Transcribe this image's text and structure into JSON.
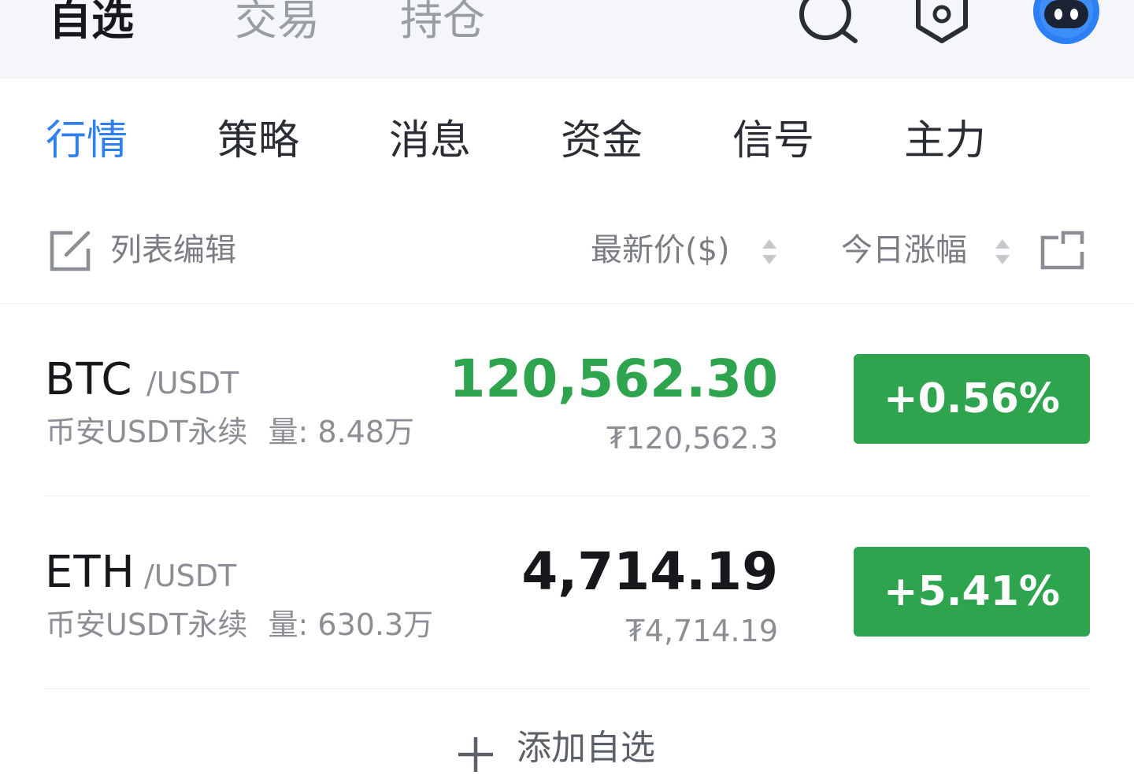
{
  "top_tabs": [
    "自选",
    "交易",
    "持仓"
  ],
  "sub_tabs": [
    "行情",
    "策略",
    "消息",
    "资金",
    "信号",
    "主力"
  ],
  "list_header": {
    "edit_label": "列表编辑",
    "price_label": "最新价($)",
    "change_label": "今日涨幅"
  },
  "rows": [
    {
      "base": "BTC",
      "quote": "/USDT",
      "exchange": "币安USDT永续",
      "volume": "量: 8.48万",
      "price": "120,562.30",
      "price_alt": "₮120,562.3",
      "change": "+0.56%",
      "price_color": "#2ea44f"
    },
    {
      "base": "ETH",
      "quote": "/USDT",
      "exchange": "币安USDT永续",
      "volume": "量: 630.3万",
      "price": "4,714.19",
      "price_alt": "₮4,714.19",
      "change": "+5.41%",
      "price_color": "#16181c"
    }
  ],
  "add_label": "添加自选",
  "colors": {
    "accent": "#2f80ed",
    "up": "#2ea44f"
  },
  "icons": {
    "search": "search-icon",
    "settings": "hexagon-settings-icon",
    "avatar": "robot-avatar-icon",
    "edit": "edit-square-icon",
    "share": "share-export-icon",
    "add": "plus-icon"
  }
}
